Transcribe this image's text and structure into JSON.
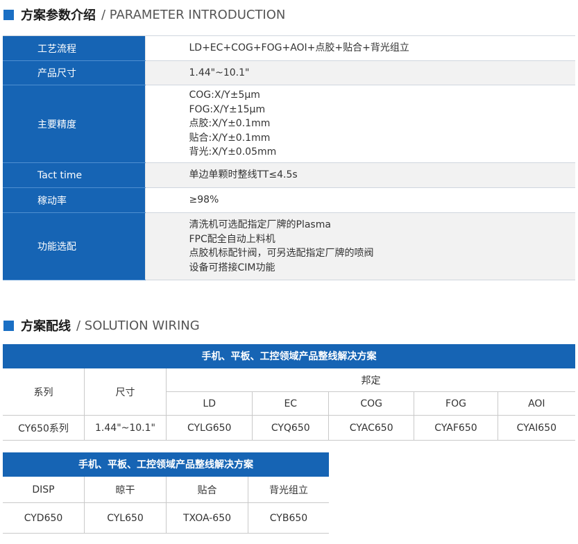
{
  "section1": {
    "zh": "方案参数介绍",
    "en": "/ PARAMETER INTRODUCTION"
  },
  "params": [
    {
      "key": "工艺流程",
      "values": [
        "LD+EC+COG+FOG+AOI+点胶+贴合+背光组立"
      ]
    },
    {
      "key": "产品尺寸",
      "values": [
        "1.44\"~10.1\""
      ]
    },
    {
      "key": "主要精度",
      "values": [
        "COG:X/Y±5μm",
        "FOG:X/Y±15μm",
        "点胶:X/Y±0.1mm",
        "贴合:X/Y±0.1mm",
        "背光:X/Y±0.05mm"
      ]
    },
    {
      "key": "Tact time",
      "values": [
        "单边单颗时整线TT≤4.5s"
      ]
    },
    {
      "key": "稼动率",
      "values": [
        "≥98%"
      ]
    },
    {
      "key": "功能选配",
      "values": [
        "清洗机可选配指定厂牌的Plasma",
        "FPC配全自动上料机",
        "点胶机标配针阀，可另选配指定厂牌的喷阀",
        "设备可搭接CIM功能"
      ]
    }
  ],
  "section2": {
    "zh": "方案配线",
    "en": "/ SOLUTION WIRING"
  },
  "wiring1": {
    "title": "手机、平板、工控领域产品整线解决方案",
    "col_series": "系列",
    "col_size": "尺寸",
    "group": "邦定",
    "sub": [
      "LD",
      "EC",
      "COG",
      "FOG",
      "AOI"
    ],
    "row": {
      "series": "CY650系列",
      "size": "1.44\"~10.1\"",
      "cells": [
        "CYLG650",
        "CYQ650",
        "CYAC650",
        "CYAF650",
        "CYAI650"
      ]
    }
  },
  "wiring2": {
    "title": "手机、平板、工控领域产品整线解决方案",
    "head": [
      "DISP",
      "晾干",
      "贴合",
      "背光组立"
    ],
    "row": [
      "CYD650",
      "CYL650",
      "TXOA-650",
      "CYB650"
    ]
  }
}
